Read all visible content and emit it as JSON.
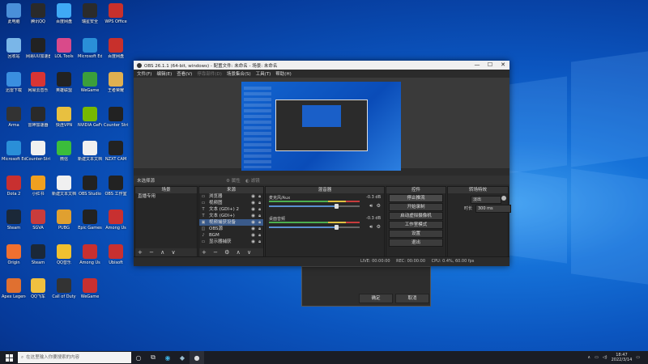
{
  "desktop": {
    "icons": [
      {
        "label": "此电脑",
        "color": "#4a8fd8"
      },
      {
        "label": "腾讯QQ",
        "color": "#2a2a2a"
      },
      {
        "label": "百度网盘",
        "color": "#3fa9f5"
      },
      {
        "label": "瑞星安全",
        "color": "#2b2b2b"
      },
      {
        "label": "WPS Office",
        "color": "#c8302c"
      },
      {
        "label": "回收站",
        "color": "#7ab6e8"
      },
      {
        "label": "网易UU加速器",
        "color": "#222"
      },
      {
        "label": "LOL Tools",
        "color": "#d94a8a"
      },
      {
        "label": "Microsoft Edge",
        "color": "#2a8fd8"
      },
      {
        "label": "百度网盘",
        "color": "#c8302c"
      },
      {
        "label": "迅雷下载",
        "color": "#3a8fe0"
      },
      {
        "label": "网易云音乐",
        "color": "#d83434"
      },
      {
        "label": "英雄联盟",
        "color": "#222"
      },
      {
        "label": "WeGame",
        "color": "#3b9f3b"
      },
      {
        "label": "王者荣耀",
        "color": "#e0b050"
      },
      {
        "label": "Arma",
        "color": "#333"
      },
      {
        "label": "雷神加速器",
        "color": "#2a2a2a"
      },
      {
        "label": "快连VPN",
        "color": "#e8c040"
      },
      {
        "label": "NVIDIA GeForce",
        "color": "#76b900"
      },
      {
        "label": "Counter Strike",
        "color": "#222"
      },
      {
        "label": "Microsoft Edge",
        "color": "#2a8fd8"
      },
      {
        "label": "Counter-Strike Global",
        "color": "#f0f0f0"
      },
      {
        "label": "微信",
        "color": "#3bbd3b"
      },
      {
        "label": "新建文本文档",
        "color": "#f0f0f0"
      },
      {
        "label": "NZXT CAM",
        "color": "#222"
      },
      {
        "label": "Dota 2",
        "color": "#c83030"
      },
      {
        "label": "小红书",
        "color": "#f0a020"
      },
      {
        "label": "新建文本文档",
        "color": "#f0f0f0"
      },
      {
        "label": "OBS Studio",
        "color": "#222"
      },
      {
        "label": "OBS 工作室",
        "color": "#222"
      },
      {
        "label": "Steam",
        "color": "#1b2838"
      },
      {
        "label": "SGVA",
        "color": "#c83c3c"
      },
      {
        "label": "PUBG",
        "color": "#e0a030"
      },
      {
        "label": "Epic Games",
        "color": "#222"
      },
      {
        "label": "Among Us",
        "color": "#c83030"
      },
      {
        "label": "Origin",
        "color": "#f07030"
      },
      {
        "label": "Steam",
        "color": "#1b2838"
      },
      {
        "label": "QQ音乐",
        "color": "#f0c030"
      },
      {
        "label": "Among Us",
        "color": "#c83030"
      },
      {
        "label": "Ubisoft",
        "color": "#c83030"
      },
      {
        "label": "Apex Legends",
        "color": "#e07030"
      },
      {
        "label": "QQ飞车",
        "color": "#f0c040"
      },
      {
        "label": "Call of Duty",
        "color": "#333"
      },
      {
        "label": "WeGame",
        "color": "#c83030"
      }
    ]
  },
  "obs": {
    "title": "OBS 26.1.1 (64-bit, windows) - 配置文件: 未命名 - 场景: 未命名",
    "window_buttons": {
      "minimize": "—",
      "maximize": "☐",
      "close": "✕"
    },
    "menu": [
      "文件(F)",
      "编辑(E)",
      "查看(V)",
      "停靠部件(D)",
      "场景集合(S)",
      "工具(T)",
      "帮助(H)"
    ],
    "scene_bar": {
      "label": "未选择源",
      "properties": "属性",
      "filters": "滤镜"
    },
    "scenes": {
      "header": "场景",
      "items": [
        "直播专用"
      ]
    },
    "sources": {
      "header": "来源",
      "items": [
        {
          "label": "浏览器",
          "icon": "▭"
        },
        {
          "label": "视频图",
          "icon": "▭"
        },
        {
          "label": "文本 (GDI+) 2",
          "icon": "T"
        },
        {
          "label": "文本 (GDI+)",
          "icon": "T"
        },
        {
          "label": "视频捕获设备",
          "icon": "▣"
        },
        {
          "label": "OBS源",
          "icon": "◫"
        },
        {
          "label": "BGM",
          "icon": "♪"
        },
        {
          "label": "显示器捕获",
          "icon": "▭"
        }
      ]
    },
    "mixer": {
      "header": "混音器",
      "channels": [
        {
          "name": "麦克风/Aux",
          "db": "-0.3 dB",
          "volume": 0.75
        },
        {
          "name": "桌面音频",
          "db": "-0.3 dB",
          "volume": 0.75
        }
      ]
    },
    "controls": {
      "header": "控件",
      "buttons": [
        "停止推流",
        "开始录制",
        "启动虚拟摄像机",
        "工作室模式",
        "设置",
        "退出"
      ]
    },
    "transitions": {
      "header": "转场特效",
      "type": "淡出",
      "duration_label": "时长",
      "duration": "300 ms"
    },
    "status": {
      "live": "LIVE: 00:00:00",
      "rec": "REC: 00:00:00",
      "cpu": "CPU: 0.4%, 60.00 fps"
    },
    "dock_footer": "+ − ∧ ∨"
  },
  "dialog": {
    "ok": "确定",
    "cancel": "取消"
  },
  "taskbar": {
    "search_placeholder": "在这里输入你要搜索的内容",
    "time": "18:47",
    "date": "2022/3/14"
  }
}
